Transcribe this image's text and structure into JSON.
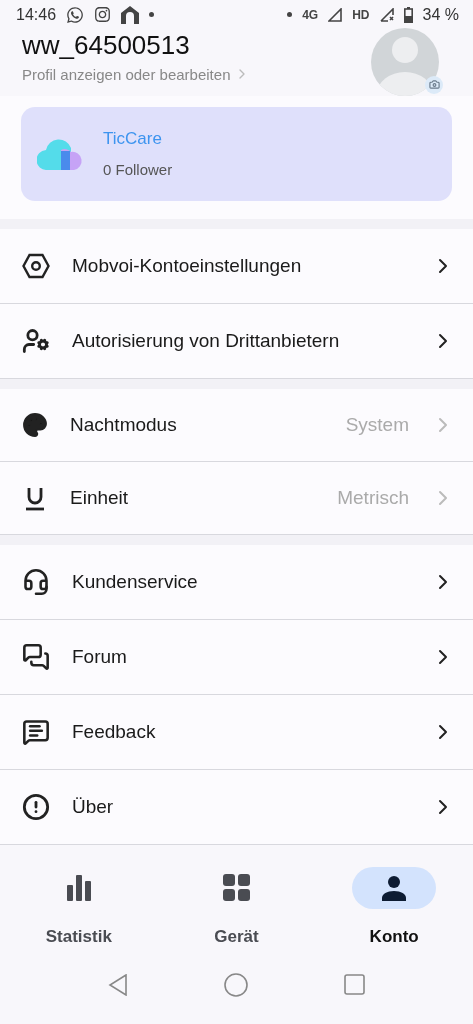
{
  "status_bar": {
    "time": "14:46",
    "network": "4G",
    "hd": "HD",
    "battery": "34 %"
  },
  "profile": {
    "name": "ww_64500513",
    "subtitle": "Profil anzeigen oder bearbeiten"
  },
  "community_card": {
    "title": "TicCare",
    "followers": "0 Follower"
  },
  "groups": [
    {
      "rows": [
        {
          "label": "Mobvoi-Kontoeinstellungen"
        },
        {
          "label": "Autorisierung von Drittanbietern"
        }
      ]
    },
    {
      "rows": [
        {
          "label": "Nachtmodus",
          "value": "System"
        },
        {
          "label": "Einheit",
          "value": "Metrisch"
        }
      ]
    },
    {
      "rows": [
        {
          "label": "Kundenservice"
        },
        {
          "label": "Forum"
        },
        {
          "label": "Feedback"
        },
        {
          "label": "Über"
        }
      ]
    }
  ],
  "bottom_nav": [
    {
      "label": "Statistik",
      "selected": false
    },
    {
      "label": "Gerät",
      "selected": false
    },
    {
      "label": "Konto",
      "selected": true
    }
  ]
}
